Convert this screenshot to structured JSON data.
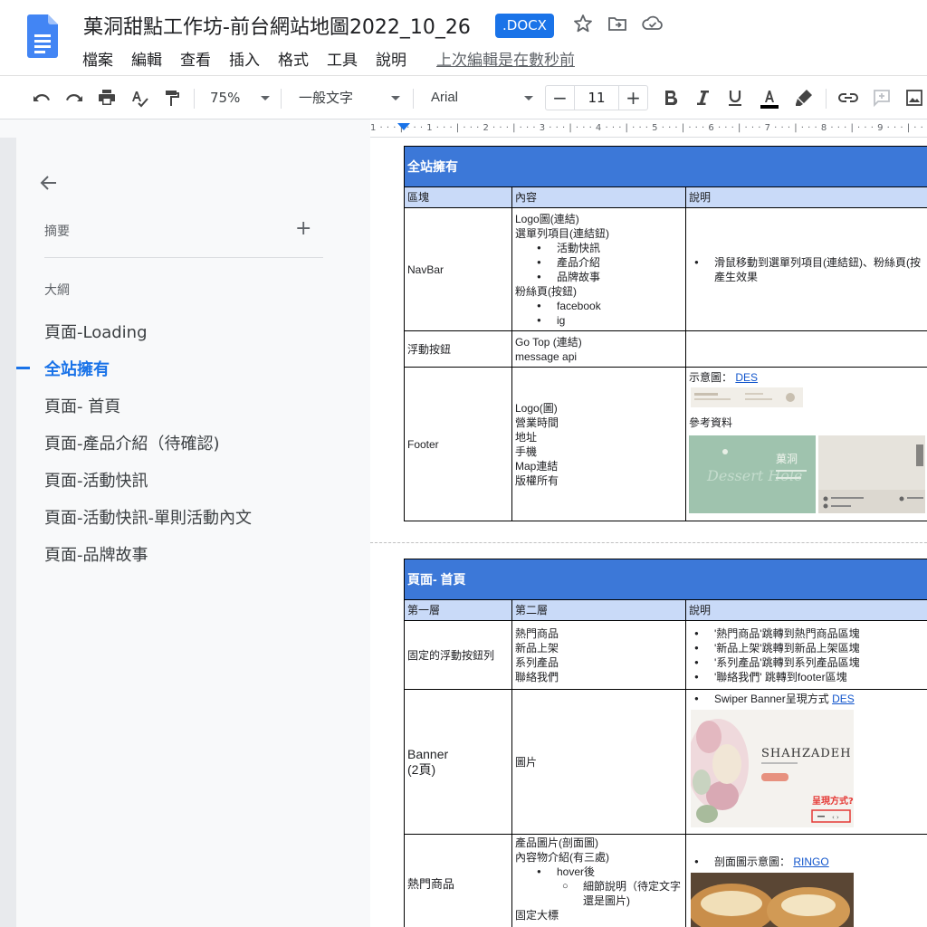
{
  "header": {
    "title": "菓洞甜點工作坊-前台網站地圖2022_10_26",
    "badge": ".DOCX",
    "menu": [
      "檔案",
      "編輯",
      "查看",
      "插入",
      "格式",
      "工具",
      "說明"
    ],
    "last_edit": "上次編輯是在數秒前",
    "icons": [
      "star-icon",
      "move-to-folder-icon",
      "cloud-status-icon"
    ]
  },
  "toolbar": {
    "zoom": "75%",
    "style": "一般文字",
    "font": "Arial",
    "font_size": "11",
    "minus": "−",
    "plus": "+",
    "icons": [
      "undo-icon",
      "redo-icon",
      "print-icon",
      "spellcheck-icon",
      "paint-format-icon",
      "bold-icon",
      "italic-icon",
      "underline-icon",
      "text-color-icon",
      "highlight-icon",
      "link-icon",
      "comment-icon",
      "image-icon"
    ],
    "text_color": "#000000"
  },
  "ruler": {
    "marks": "1 · · · | · · · 1 · · · | · · · 2 · · · | · · · 3 · · · | · · · 4 · · · | · · · 5 · · · | · · · 6 · · · | · · · 7 · · · | · · · 8 · · · | · · · 9 · · · | · · · 10 · · · | · · · 11 · · · | · · · 12 · · · | · · · 13 · · · | · · · 14 · · · | · · · 15 · · · |"
  },
  "sidebar": {
    "summary": "摘要",
    "add": "+",
    "outline": "大綱",
    "items": [
      {
        "label": "頁面-Loading",
        "active": false
      },
      {
        "label": "全站擁有",
        "active": true
      },
      {
        "label": "頁面- 首頁",
        "active": false
      },
      {
        "label": "頁面-產品介紹（待確認)",
        "active": false
      },
      {
        "label": "頁面-活動快訊",
        "active": false
      },
      {
        "label": "頁面-活動快訊-單則活動內文",
        "active": false
      },
      {
        "label": "頁面-品牌故事",
        "active": false
      }
    ]
  },
  "table1": {
    "title": "全站擁有",
    "headers": [
      "區塊",
      "內容",
      "說明"
    ],
    "navbar": {
      "name": "NavBar",
      "content": [
        "Logo圖(連結)",
        "選單列項目(連結鈕)",
        "活動快訊",
        "產品介紹",
        "品牌故事",
        "粉絲頁(按鈕)",
        "facebook",
        "ig"
      ],
      "note": "滑鼠移動到選單列項目(連結鈕)、粉絲頁(按",
      "note2": "產生效果"
    },
    "float": {
      "name": "浮動按鈕",
      "content": [
        "Go Top (連結)",
        "message api"
      ]
    },
    "footer": {
      "name": "Footer",
      "content": [
        "Logo(圖)",
        "營業時間",
        "地址",
        "手機",
        "Map連結",
        "版權所有"
      ],
      "sample_label": "示意圖：",
      "sample_link": "DES",
      "ref_label": "參考資料",
      "card_brand": "菓洞",
      "card_script": "Dessert Hole"
    }
  },
  "table2": {
    "title": "頁面- 首頁",
    "headers": [
      "第一層",
      "第二層",
      "說明"
    ],
    "float_row": {
      "name": "固定的浮動按鈕列",
      "content": [
        "熱門商品",
        "新品上架",
        "系列產品",
        "聯絡我們"
      ],
      "notes": [
        "'熱門商品'跳轉到熱門商品區塊",
        "'新品上架'跳轉到新品上架區塊",
        "'系列產品'跳轉到系列產品區塊",
        "'聯絡我們' 跳轉到footer區塊"
      ]
    },
    "banner_row": {
      "name": "Banner",
      "name2": "(2頁)",
      "content": "圖片",
      "note": "Swiper Banner呈現方式",
      "note_link": "DES",
      "img_title": "SHAHZADEH",
      "img_question": "呈現方式?"
    },
    "hot_row": {
      "name": "熱門商品",
      "content": [
        "產品圖片(剖面圖)",
        "內容物介紹(有三處)",
        "hover後",
        "細節說明（待定文字",
        "還是圖片)",
        "固定大標"
      ],
      "note": "剖面圖示意圖：",
      "note_link": "RINGO"
    }
  }
}
